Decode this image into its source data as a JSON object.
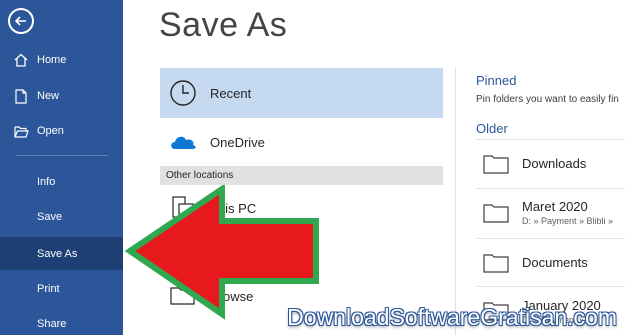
{
  "sidebar": {
    "back_icon": "back-arrow-icon",
    "items": [
      {
        "label": "Home",
        "icon": "home-icon"
      },
      {
        "label": "New",
        "icon": "new-document-icon"
      },
      {
        "label": "Open",
        "icon": "open-folder-icon"
      },
      {
        "label": "Info"
      },
      {
        "label": "Save"
      },
      {
        "label": "Save As",
        "selected": true
      },
      {
        "label": "Print"
      },
      {
        "label": "Share"
      }
    ],
    "colors": {
      "background": "#2b579a",
      "selected": "#1d3f74"
    }
  },
  "main": {
    "title": "Save As",
    "locations": [
      {
        "label": "Recent",
        "icon": "clock-icon",
        "selected": true
      },
      {
        "label": "OneDrive",
        "icon": "onedrive-cloud-icon"
      }
    ],
    "other_locations_header": "Other locations",
    "other_locations": [
      {
        "label": "This PC",
        "icon": "computer-icon"
      },
      {
        "label": "Browse",
        "icon": "folder-icon"
      }
    ]
  },
  "right_pane": {
    "pinned_title": "Pinned",
    "pinned_description": "Pin folders you want to easily fin",
    "older_title": "Older",
    "folders": [
      {
        "name": "Downloads",
        "path": ""
      },
      {
        "name": "Maret 2020",
        "path": "D: » Payment » Blibli » "
      },
      {
        "name": "Documents",
        "path": ""
      },
      {
        "name": "January 2020",
        "path": "D: » Payment » "
      }
    ],
    "accent_color": "#2b579a"
  },
  "annotation": {
    "arrow_icon": "red-arrow-icon",
    "arrow_fill": "#e8191c",
    "arrow_stroke": "#2fa84f"
  },
  "watermark": "DownloadSoftwareGratisan.com"
}
